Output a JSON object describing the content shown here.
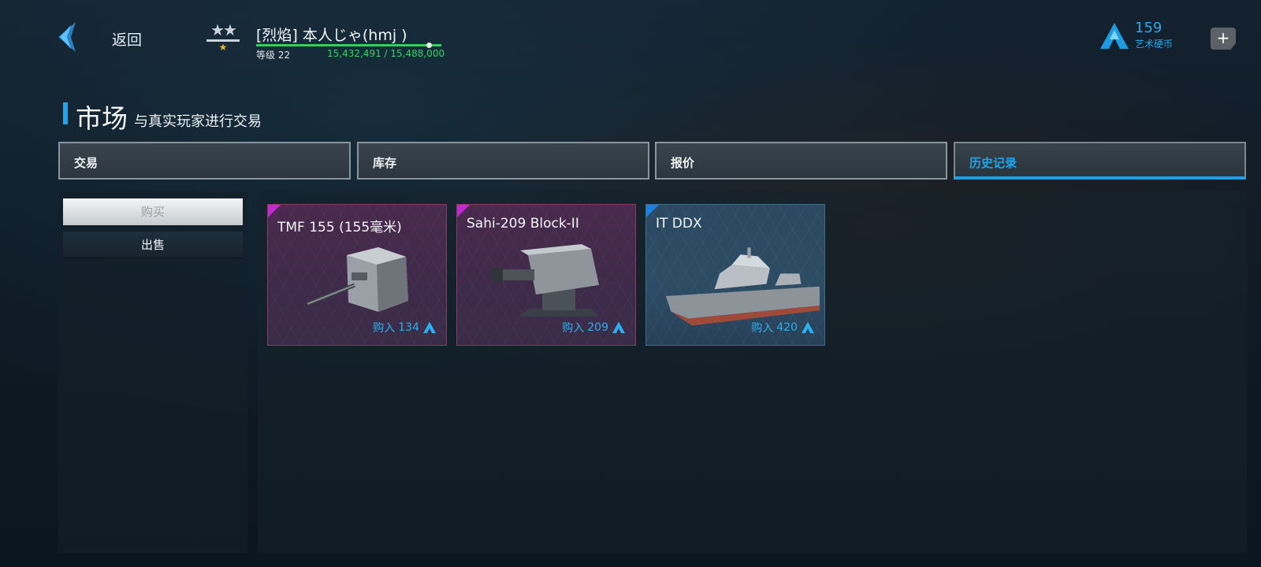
{
  "topbar": {
    "back_label": "返回",
    "player_name": "[烈焰] 本人じゃ(hmj )",
    "level_label": "等级 22",
    "xp_text": "15,432,491 / 15,488,000",
    "xp_progress": 0.996,
    "rank_stars_top": "★★",
    "rank_stars_bottom": "★",
    "currency_amount": "159",
    "currency_label": "艺术硬币",
    "add_label": "+"
  },
  "header": {
    "title": "市场",
    "subtitle": "与真实玩家进行交易"
  },
  "tabs": [
    {
      "label": "交易",
      "active": false
    },
    {
      "label": "库存",
      "active": false
    },
    {
      "label": "报价",
      "active": false
    },
    {
      "label": "历史记录",
      "active": true
    }
  ],
  "side_menu": {
    "buy_label": "购买",
    "sell_label": "出售"
  },
  "items": [
    {
      "name": "TMF 155 (155毫米)",
      "price_prefix": "购入",
      "price": "134",
      "rarity": "epic",
      "rarity_color": "#c12ad0"
    },
    {
      "name": "Sahi-209 Block-II",
      "price_prefix": "购入",
      "price": "209",
      "rarity": "epic",
      "rarity_color": "#c12ad0"
    },
    {
      "name": "IT DDX",
      "price_prefix": "购入",
      "price": "420",
      "rarity": "rare",
      "rarity_color": "#1d7fe0"
    }
  ],
  "icons": {
    "back": "chevron-left-icon",
    "currency": "art-coin-icon",
    "add": "plus-icon"
  },
  "colors": {
    "accent": "#1fa4ec",
    "xp_green": "#2ed35a",
    "epic": "#c12ad0",
    "rare": "#1d7fe0"
  }
}
